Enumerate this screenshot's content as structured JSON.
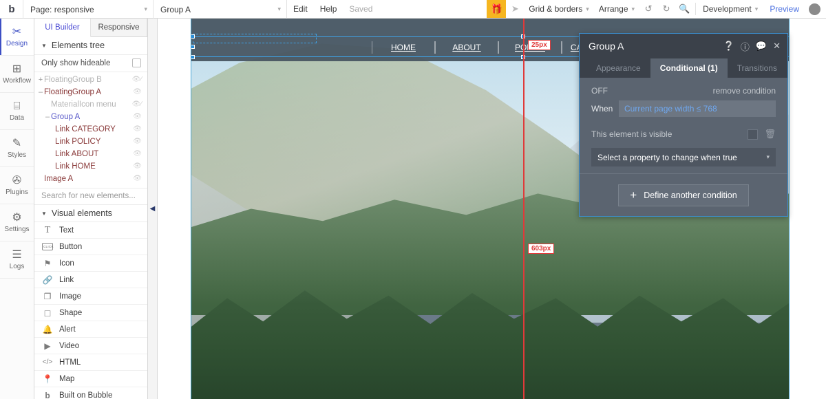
{
  "topbar": {
    "logo": "b",
    "page_select": {
      "label": "Page: responsive",
      "caret": "▾"
    },
    "group_select": {
      "label": "Group A",
      "caret": "▾"
    },
    "edit": "Edit",
    "help": "Help",
    "saved": "Saved",
    "gift_icon": "🎁",
    "cursor_icon": "➤",
    "grid_borders": "Grid & borders",
    "arrange": "Arrange",
    "undo_icon": "↺",
    "redo_icon": "↻",
    "search_icon": "🔍",
    "version": "Development",
    "preview": "Preview",
    "avatar_icon": "👤",
    "caret": "▾"
  },
  "rail": {
    "items": [
      {
        "label": "Design",
        "icon": "✂",
        "active": true
      },
      {
        "label": "Workflow",
        "icon": "⊞",
        "active": false
      },
      {
        "label": "Data",
        "icon": "⌸",
        "active": false
      },
      {
        "label": "Styles",
        "icon": "✎",
        "active": false
      },
      {
        "label": "Plugins",
        "icon": "✇",
        "active": false
      },
      {
        "label": "Settings",
        "icon": "⚙",
        "active": false
      },
      {
        "label": "Logs",
        "icon": "☰",
        "active": false
      }
    ]
  },
  "panel": {
    "tabs": [
      {
        "label": "UI Builder",
        "active": true
      },
      {
        "label": "Responsive",
        "active": false
      }
    ],
    "elements_tree_title": "Elements tree",
    "only_show_hideable": "Only show hideable",
    "tree": [
      {
        "name": "FloatingGroup B",
        "expander": "+",
        "indent": 0,
        "color": "c-grey",
        "eye": "hidden"
      },
      {
        "name": "FloatingGroup A",
        "expander": "–",
        "indent": 0,
        "color": "c-red",
        "eye": "visible"
      },
      {
        "name": "MaterialIcon menu",
        "expander": "",
        "indent": 14,
        "color": "c-grey",
        "eye": "hidden"
      },
      {
        "name": "Group A",
        "expander": "–",
        "indent": 10,
        "color": "c-blue",
        "eye": "visible"
      },
      {
        "name": "Link CATEGORY",
        "expander": "",
        "indent": 24,
        "color": "c-red",
        "eye": "visible"
      },
      {
        "name": "Link POLICY",
        "expander": "",
        "indent": 24,
        "color": "c-red",
        "eye": "visible"
      },
      {
        "name": "Link ABOUT",
        "expander": "",
        "indent": 24,
        "color": "c-red",
        "eye": "visible"
      },
      {
        "name": "Link HOME",
        "expander": "",
        "indent": 24,
        "color": "c-red",
        "eye": "visible"
      },
      {
        "name": "Image A",
        "expander": "",
        "indent": 0,
        "color": "c-red",
        "eye": "visible"
      }
    ],
    "search_placeholder": "Search for new elements...",
    "visual_elements_title": "Visual elements",
    "visual_elements": [
      {
        "label": "Text",
        "icon": "T"
      },
      {
        "label": "Button",
        "icon": "CLICK"
      },
      {
        "label": "Icon",
        "icon": "⚑"
      },
      {
        "label": "Link",
        "icon": "🔗"
      },
      {
        "label": "Image",
        "icon": "❐"
      },
      {
        "label": "Shape",
        "icon": "□"
      },
      {
        "label": "Alert",
        "icon": "🔔"
      },
      {
        "label": "Video",
        "icon": "▶"
      },
      {
        "label": "HTML",
        "icon": "</>"
      },
      {
        "label": "Map",
        "icon": "📍"
      },
      {
        "label": "Built on Bubble",
        "icon": "b"
      }
    ],
    "collapse_icon": "◀"
  },
  "canvas": {
    "nav_links": [
      "HOME",
      "ABOUT",
      "POLICY",
      "CATEGORY"
    ],
    "guide_top_label": "25px",
    "guide_bottom_label": "603px"
  },
  "popup": {
    "title": "Group A",
    "header_icons": {
      "help": "?",
      "info": "i",
      "comment": "💬",
      "close": "✕"
    },
    "tabs": [
      {
        "label": "Appearance",
        "active": false
      },
      {
        "label": "Conditional (1)",
        "active": true
      },
      {
        "label": "Transitions",
        "active": false
      }
    ],
    "off_label": "OFF",
    "remove_condition": "remove condition",
    "when_label": "When",
    "when_value": "Current page width ≤ 768",
    "visible_label": "This element is visible",
    "trash_icon": "🗑",
    "select_property": "Select a property to change when true",
    "select_caret": "▾",
    "define_another": "Define another condition",
    "plus_icon": "+"
  },
  "colors": {
    "accent_blue": "#4a4ad4",
    "selection_blue": "#3ea3e8",
    "guide_red": "#e03a3a",
    "gift_yellow": "#f6b620",
    "popup_bg": "#5b6470",
    "popup_header": "#3b414a"
  }
}
